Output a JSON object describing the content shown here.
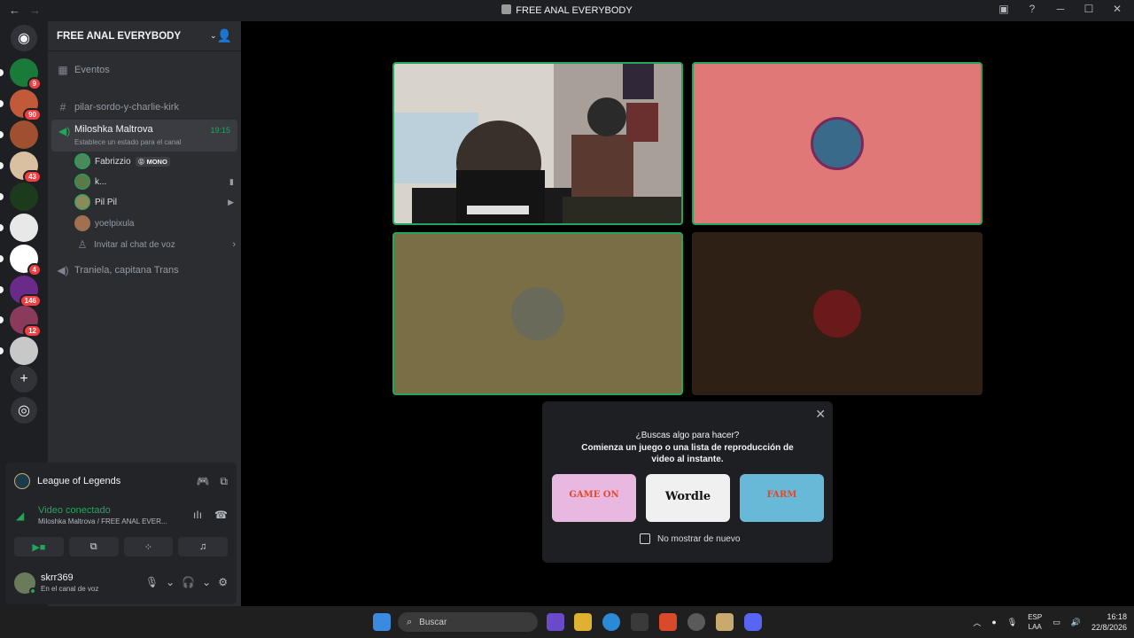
{
  "window": {
    "back_icon": "arrow-left-icon",
    "forward_icon": "arrow-right-icon",
    "title": "FREE ANAL EVERYBODY"
  },
  "rail": {
    "servers": [
      {
        "badge": "9",
        "color": "#1a7a3a"
      },
      {
        "badge": "90",
        "color": "#c25a3a"
      },
      {
        "badge": "",
        "color": "#a05030"
      },
      {
        "badge": "43",
        "color": "#d8c0a0"
      },
      {
        "badge": "",
        "color": "#1c3a1c"
      },
      {
        "badge": "",
        "color": "#e8e8e8"
      },
      {
        "badge": "4",
        "color": "#ffffff"
      },
      {
        "badge": "146",
        "color": "#6a2a8a"
      },
      {
        "badge": "12",
        "color": "#8a3a5a"
      },
      {
        "badge": "",
        "color": "#c8c8c8"
      }
    ]
  },
  "sidebar": {
    "server_name": "FREE ANAL EVERYBODY",
    "events": "Eventos",
    "text_channel": "pilar-sordo-y-charlie-kirk",
    "voice_channel": {
      "name": "Miloshka Maltrova",
      "status": "Establece un estado para el canal",
      "time": "19:15",
      "members": [
        {
          "name": "Fabrizzio",
          "tag": "😝 MONO",
          "color": "#4a8a5a"
        },
        {
          "name": "k...",
          "tag": "",
          "color": "#5a7a4a"
        },
        {
          "name": "Pil Pil",
          "tag": "",
          "color": "#8a8a5a"
        },
        {
          "name": "yoelpixula",
          "tag": "",
          "color": "#a07050"
        }
      ],
      "invite": "Invitar al chat de voz"
    },
    "other_voice": "Traniela, capitana Trans"
  },
  "activity": {
    "game": "League of Legends",
    "voice_status": "Video conectado",
    "voice_path": "Miloshka Maltrova / FREE ANAL EVER..."
  },
  "user": {
    "name": "skrr369",
    "status": "En el canal de voz"
  },
  "tiles": [
    {
      "bg": "#3a3634",
      "speaking": true
    },
    {
      "bg": "#e07878",
      "speaking": true
    },
    {
      "bg": "#7a6e44",
      "speaking": true
    },
    {
      "bg": "#2e2014",
      "speaking": false
    }
  ],
  "popup": {
    "question": "¿Buscas algo para hacer?",
    "description": "Comienza un juego o una lista de reproducción de video al instante.",
    "games": [
      {
        "label": "GAME ON",
        "color": "#e8b8e0"
      },
      {
        "label": "Wordle",
        "color": "#f0f0f0"
      },
      {
        "label": "FARM",
        "color": "#68b8d8"
      }
    ],
    "checkbox": "No mostrar de nuevo"
  },
  "taskbar": {
    "search": "Buscar",
    "lang1": "ESP",
    "lang2": "LAA",
    "time": "16:18",
    "date": "22/8/2026"
  }
}
